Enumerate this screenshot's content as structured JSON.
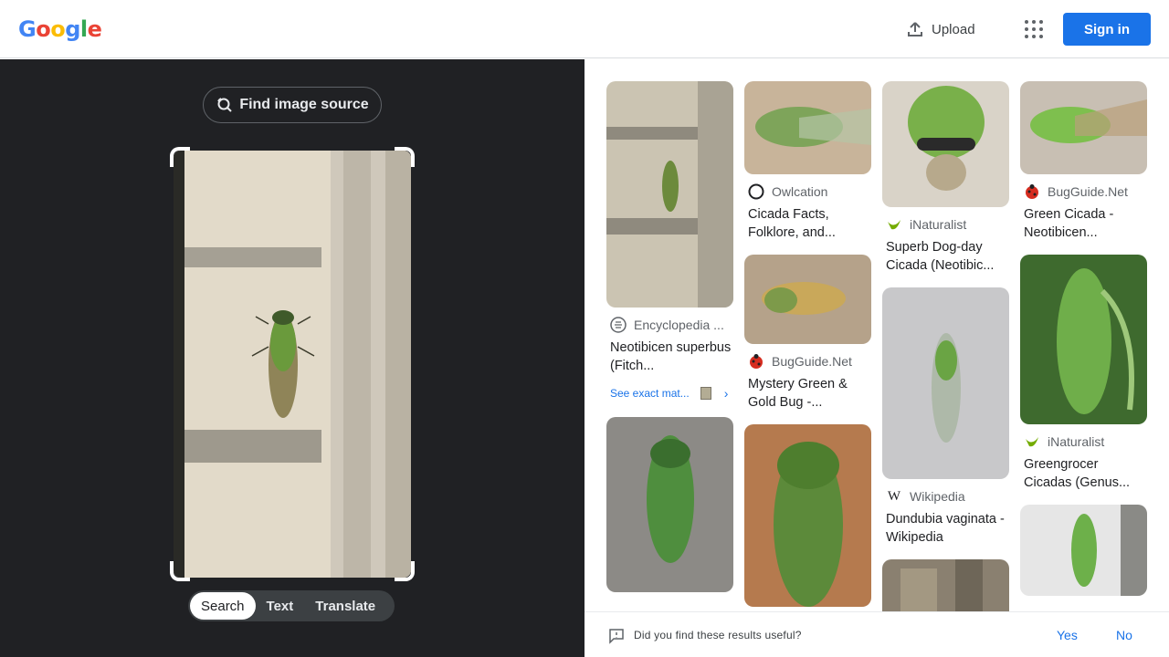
{
  "header": {
    "logo": [
      "G",
      "o",
      "o",
      "g",
      "l",
      "e"
    ],
    "logo_colors": [
      "#4285F4",
      "#EA4335",
      "#FBBC05",
      "#4285F4",
      "#34A853",
      "#EA4335"
    ],
    "upload_label": "Upload",
    "signin_label": "Sign in"
  },
  "left_panel": {
    "find_source_label": "Find image source",
    "modes": [
      "Search",
      "Text",
      "Translate"
    ],
    "active_mode": "Search"
  },
  "results": {
    "see_exact_label": "See exact mat...",
    "columns": [
      [
        {
          "source": "Encyclopedia ...",
          "title": "Neotibicen superbus (Fitch...",
          "favicon": "encyclopedia-icon"
        },
        {
          "source": "",
          "title": "",
          "favicon": ""
        }
      ],
      [
        {
          "source": "Owlcation",
          "title": "Cicada Facts, Folklore, and...",
          "favicon": "owlcation-icon"
        },
        {
          "source": "BugGuide.Net",
          "title": "Mystery Green & Gold Bug -...",
          "favicon": "bugguide-icon"
        },
        {
          "source": "",
          "title": "",
          "favicon": ""
        }
      ],
      [
        {
          "source": "iNaturalist",
          "title": "Superb Dog-day Cicada (Neotibic...",
          "favicon": "inaturalist-icon"
        },
        {
          "source": "Wikipedia",
          "title": "Dundubia vaginata - Wikipedia",
          "favicon": "wikipedia-icon"
        },
        {
          "source": "",
          "title": "",
          "favicon": ""
        }
      ],
      [
        {
          "source": "BugGuide.Net",
          "title": "Green Cicada - Neotibicen...",
          "favicon": "bugguide-icon"
        },
        {
          "source": "iNaturalist",
          "title": "Greengrocer Cicadas (Genus...",
          "favicon": "inaturalist-icon"
        },
        {
          "source": "",
          "title": "",
          "favicon": ""
        }
      ]
    ]
  },
  "feedback": {
    "question": "Did you find these results useful?",
    "yes": "Yes",
    "no": "No"
  }
}
